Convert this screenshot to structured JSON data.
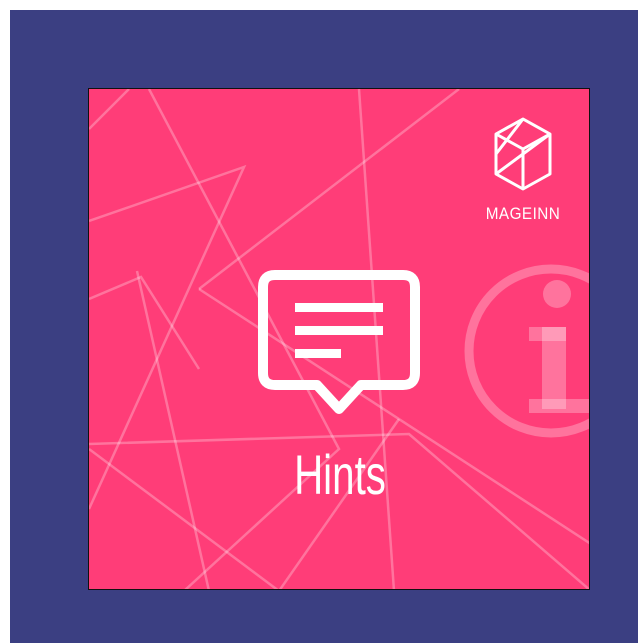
{
  "brand": {
    "name": "MAGEINN",
    "logo_icon": "hexagon-cube-icon"
  },
  "product": {
    "title": "Hints",
    "icon": "speech-bubble-lines-icon",
    "watermark_icon": "info-icon"
  },
  "colors": {
    "frame": "#3b3f82",
    "card": "#ff3d78",
    "foreground": "#ffffff"
  }
}
